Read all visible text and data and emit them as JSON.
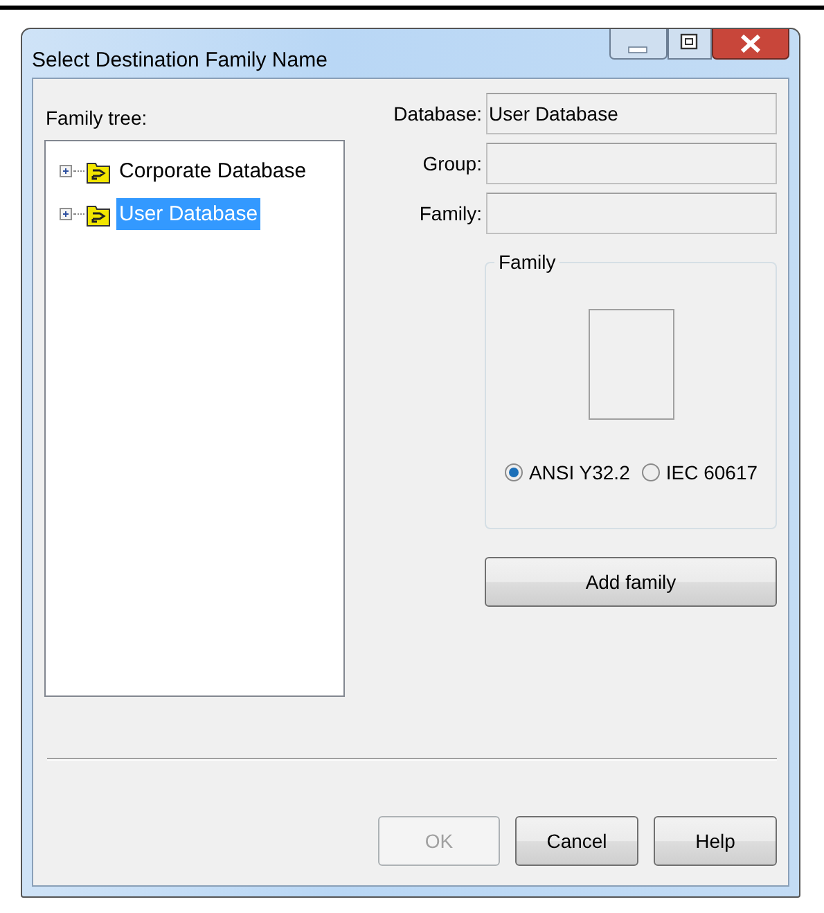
{
  "window": {
    "title": "Select Destination Family Name"
  },
  "family_tree": {
    "label": "Family tree:",
    "items": [
      {
        "label": "Corporate Database",
        "expanded": false,
        "selected": false
      },
      {
        "label": "User Database",
        "expanded": false,
        "selected": true
      }
    ]
  },
  "fields": [
    {
      "label": "Database:",
      "value": "User Database"
    },
    {
      "label": "Group:"
    },
    {
      "label": "Family:"
    }
  ],
  "family_group": {
    "title": "Family",
    "options": [
      {
        "label": "ANSI Y32.2",
        "selected": true
      },
      {
        "label": "IEC 60617",
        "selected": false
      }
    ]
  },
  "add_button": {
    "label": "Add family"
  },
  "buttons": [
    {
      "label": "OK",
      "disabled": true
    },
    {
      "label": "Cancel",
      "disabled": false
    },
    {
      "label": "Help",
      "disabled": false
    }
  ]
}
